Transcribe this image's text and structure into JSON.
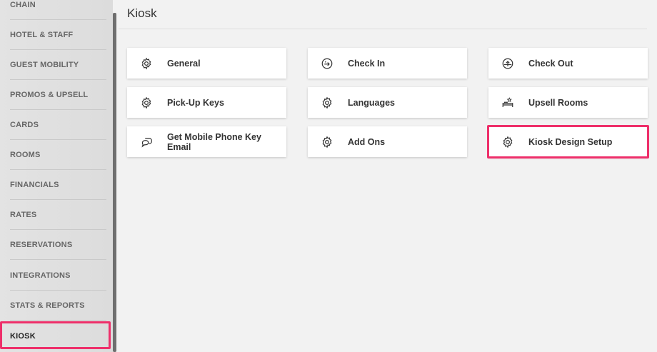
{
  "sidebar": {
    "items": [
      {
        "label": "CHAIN"
      },
      {
        "label": "HOTEL & STAFF"
      },
      {
        "label": "GUEST MOBILITY"
      },
      {
        "label": "PROMOS & UPSELL"
      },
      {
        "label": "CARDS"
      },
      {
        "label": "ROOMS"
      },
      {
        "label": "FINANCIALS"
      },
      {
        "label": "RATES"
      },
      {
        "label": "RESERVATIONS"
      },
      {
        "label": "INTEGRATIONS"
      },
      {
        "label": "STATS & REPORTS"
      },
      {
        "label": "KIOSK"
      }
    ],
    "active": "KIOSK"
  },
  "page": {
    "title": "Kiosk"
  },
  "tiles": [
    {
      "label": "General",
      "icon": "gear-icon"
    },
    {
      "label": "Check In",
      "icon": "check-in-icon"
    },
    {
      "label": "Check Out",
      "icon": "check-out-icon"
    },
    {
      "label": "Pick-Up Keys",
      "icon": "gear-icon"
    },
    {
      "label": "Languages",
      "icon": "gear-icon"
    },
    {
      "label": "Upsell Rooms",
      "icon": "upsell-bed-icon"
    },
    {
      "label": "Get Mobile Phone Key Email",
      "icon": "chat-bubbles-icon"
    },
    {
      "label": "Add Ons",
      "icon": "gear-icon"
    },
    {
      "label": "Kiosk Design Setup",
      "icon": "gear-icon"
    }
  ],
  "colors": {
    "highlight": "#ee2f6a"
  }
}
